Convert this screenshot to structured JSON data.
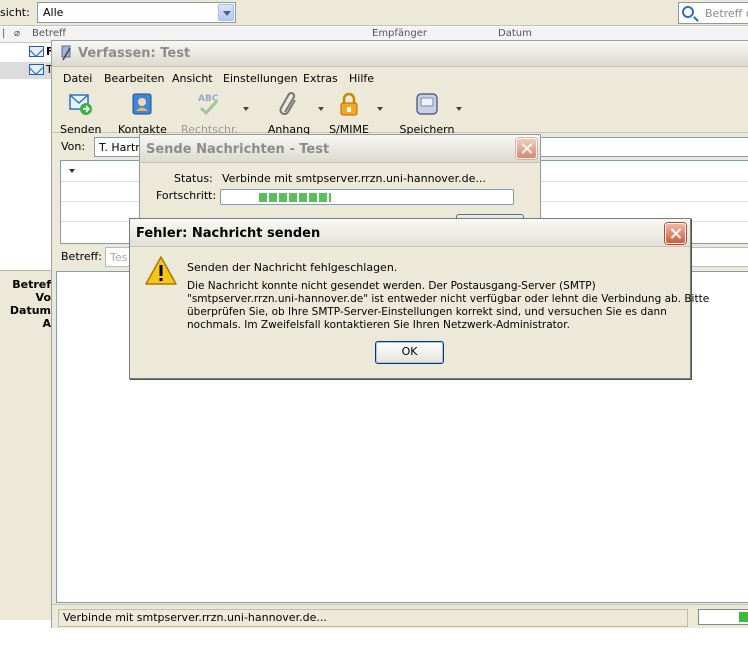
{
  "main": {
    "view_label": "sicht:",
    "view_value": "Alle",
    "search_placeholder": "Betreff o",
    "list_columns": [
      "Betreff",
      "Empfänger",
      "Datum"
    ],
    "list_rows": [
      "F",
      "T"
    ],
    "preview_labels": [
      "Betref",
      "Vo",
      "Datum",
      "A"
    ]
  },
  "compose": {
    "title": "Verfassen: Test",
    "menu": [
      "Datei",
      "Bearbeiten",
      "Ansicht",
      "Einstellungen",
      "Extras",
      "Hilfe"
    ],
    "toolbar": {
      "send": "Senden",
      "contacts": "Kontakte",
      "spell": "Rechtschr.",
      "attach": "Anhang",
      "smime": "S/MIME",
      "save": "Speichern",
      "spell_icon_text": "ABC"
    },
    "from_label": "Von:",
    "from_value": "T. Hartm",
    "subject_label": "Betreff:",
    "subject_value": "Tes",
    "status": "Verbinde mit smtpserver.rrzn.uni-hannover.de..."
  },
  "send_dialog": {
    "title": "Sende Nachrichten - Test",
    "status_label": "Status:",
    "status_value": "Verbinde mit smtpserver.rrzn.uni-hannover.de...",
    "progress_label": "Fortschritt:"
  },
  "error_dialog": {
    "title": "Fehler: Nachricht senden",
    "heading": "Senden der Nachricht fehlgeschlagen.",
    "lines": [
      "Die Nachricht konnte nicht gesendet werden. Der Postausgang-Server (SMTP)",
      "\"smtpserver.rrzn.uni-hannover.de\" ist entweder nicht verfügbar oder lehnt die Verbindung ab. Bitte",
      "überprüfen Sie, ob Ihre SMTP-Server-Einstellungen korrekt sind, und versuchen Sie es dann",
      "nochmals. Im Zweifelsfall kontaktieren Sie Ihren Netzwerk-Administrator."
    ],
    "ok_label": "OK"
  },
  "colors": {
    "progress": "#5abf5a",
    "close": "#d35b3c",
    "warning": "#f5c518"
  }
}
